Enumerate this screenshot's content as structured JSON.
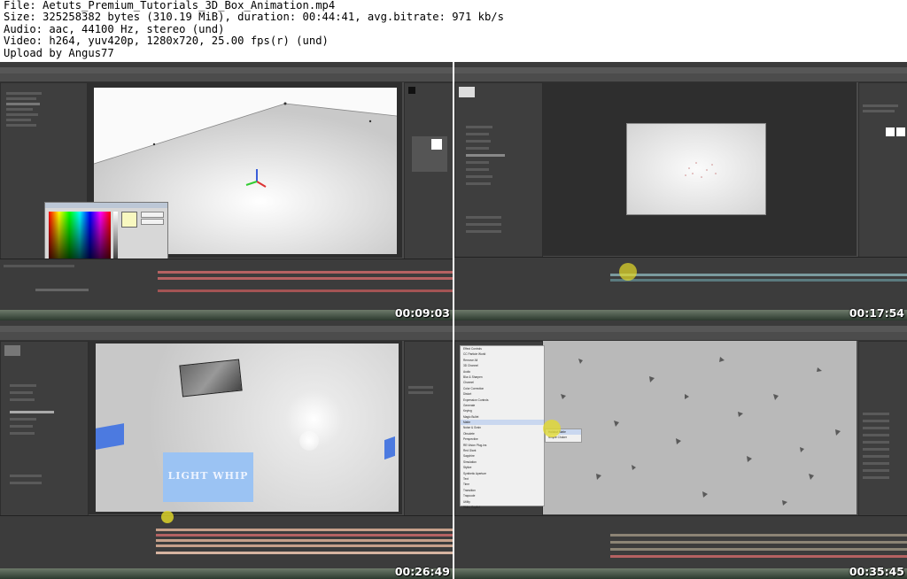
{
  "header": {
    "file": "File: Aetuts_Premium_Tutorials_3D_Box_Animation.mp4",
    "size": "Size: 325258382 bytes (310.19 MiB), duration: 00:44:41, avg.bitrate: 971 kb/s",
    "audio": "Audio: aac, 44100 Hz, stereo (und)",
    "video": "Video: h264, yuv420p, 1280x720, 25.00 fps(r) (und)",
    "upload": "Upload by Angus77"
  },
  "thumbnails": [
    {
      "timestamp": "00:09:03",
      "scene": "3D floor with color picker dialog"
    },
    {
      "timestamp": "00:17:54",
      "scene": "Composition with particle preview"
    },
    {
      "timestamp": "00:26:49",
      "scene": "3D layers with Light Whip text"
    },
    {
      "timestamp": "00:35:45",
      "scene": "Effects menu over particle field"
    }
  ],
  "thumb3": {
    "text_layer": "LIGHT WHIP"
  },
  "thumb4": {
    "menu_items": [
      "Effect Controls",
      "CC Particle World",
      "Remove All",
      "3D Channel",
      "Audio",
      "Blur & Sharpen",
      "Channel",
      "Color Correction",
      "Distort",
      "Expression Controls",
      "Generate",
      "Keying",
      "Magic Bullet",
      "Matte",
      "Noise & Grain",
      "Obsolete",
      "Perspective",
      "RE:Vision Plug-ins",
      "Red Giant",
      "Sapphire",
      "Simulation",
      "Stylize",
      "Synthetic Aperture",
      "Text",
      "Time",
      "Transition",
      "Trapcode",
      "Utility",
      "Video Copilot"
    ],
    "submenu": [
      "Holdout Matte",
      "Simple Choker"
    ]
  },
  "app_menu": [
    "File",
    "Edit",
    "Composition",
    "Layer",
    "Effect",
    "Animation",
    "View",
    "Window",
    "Help"
  ]
}
